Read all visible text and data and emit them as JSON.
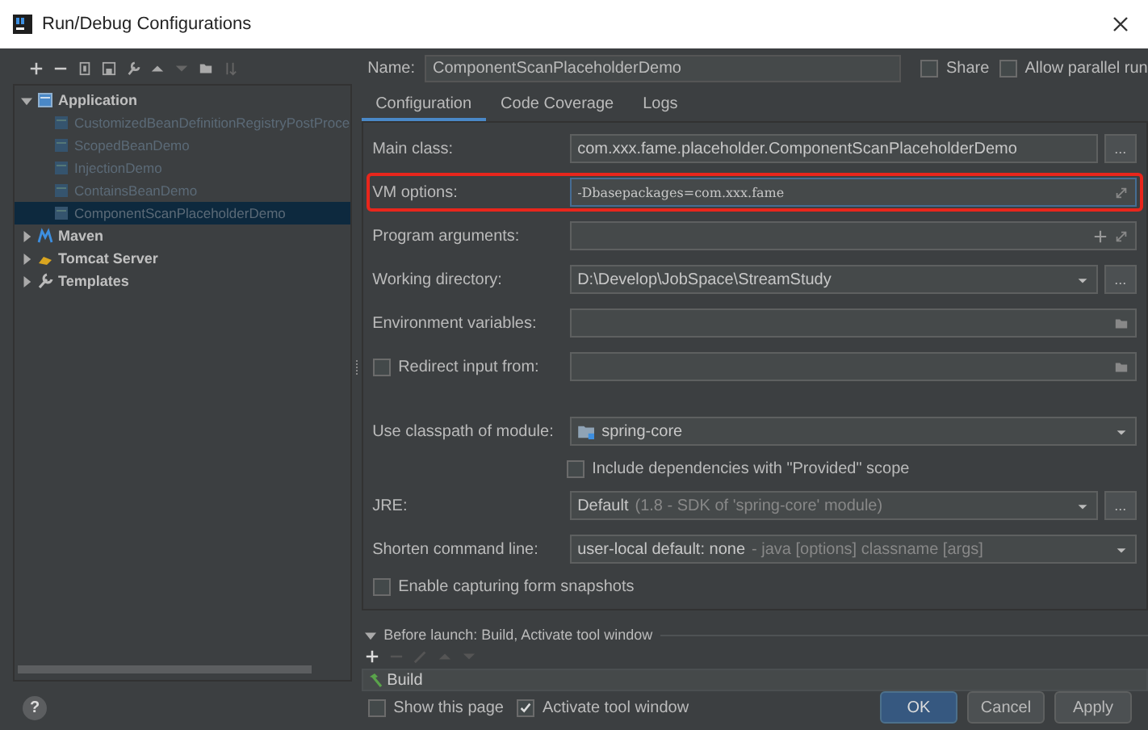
{
  "window": {
    "title": "Run/Debug Configurations"
  },
  "tree": [
    {
      "label": "Application",
      "expanded": true,
      "children": [
        {
          "label": "CustomizedBeanDefinitionRegistryPostProce",
          "selected": false
        },
        {
          "label": "ScopedBeanDemo",
          "selected": false
        },
        {
          "label": "InjectionDemo",
          "selected": false
        },
        {
          "label": "ContainsBeanDemo",
          "selected": false
        },
        {
          "label": "ComponentScanPlaceholderDemo",
          "selected": true
        }
      ]
    },
    {
      "label": "Maven",
      "expanded": false
    },
    {
      "label": "Tomcat Server",
      "expanded": false
    },
    {
      "label": "Templates",
      "expanded": false
    }
  ],
  "name": {
    "label": "Name:",
    "value": "ComponentScanPlaceholderDemo"
  },
  "top_checks": [
    {
      "label": "Share",
      "checked": false
    },
    {
      "label": "Allow parallel run",
      "checked": false
    }
  ],
  "tabs": [
    {
      "label": "Configuration",
      "selected": true
    },
    {
      "label": "Code Coverage",
      "selected": false
    },
    {
      "label": "Logs",
      "selected": false
    }
  ],
  "form": [
    {
      "kind": "field",
      "label": "Main class:",
      "value": "com.xxx.fame.placeholder.ComponentScanPlaceholderDemo",
      "browse": "..."
    },
    {
      "kind": "field",
      "label": "VM options:",
      "value": "-Dbasepackages=com.xxx.fame",
      "expand": true,
      "highlighted": true
    },
    {
      "kind": "field",
      "label": "Program arguments:",
      "plus": true,
      "expand": true
    },
    {
      "kind": "field",
      "label": "Working directory:",
      "value": "D:\\Develop\\JobSpace\\StreamStudy",
      "dropdown": true,
      "browse": "..."
    },
    {
      "kind": "field",
      "label": "Environment variables:",
      "folder": true
    },
    {
      "kind": "field",
      "label": "Redirect input from:",
      "checked": false,
      "folder": true
    },
    {
      "kind": "gap"
    },
    {
      "kind": "field",
      "label": "Use classpath of module:",
      "value": "spring-core",
      "module_icon": true,
      "dropdown": true
    },
    {
      "kind": "check",
      "label": "Include dependencies with \"Provided\" scope",
      "checked": false,
      "indent": true
    },
    {
      "kind": "field",
      "label": "JRE:",
      "value": "Default",
      "hint": "(1.8 - SDK of 'spring-core' module)",
      "dropdown": true,
      "browse": "..."
    },
    {
      "kind": "field",
      "label": "Shorten command line:",
      "value": "user-local default: none",
      "hint": "- java [options] classname [args]",
      "dropdown": true
    },
    {
      "kind": "check",
      "label": "Enable capturing form snapshots",
      "checked": false
    }
  ],
  "before_launch": {
    "title": "Before launch: Build, Activate tool window",
    "expanded": true,
    "tasks": [
      "Build"
    ]
  },
  "launch_checks": [
    {
      "label": "Show this page",
      "checked": false
    },
    {
      "label": "Activate tool window",
      "checked": true
    }
  ],
  "help": "?",
  "buttons": [
    {
      "label": "OK",
      "kind": "primary"
    },
    {
      "label": "Cancel",
      "kind": "normal"
    },
    {
      "label": "Apply",
      "kind": "normal"
    }
  ]
}
